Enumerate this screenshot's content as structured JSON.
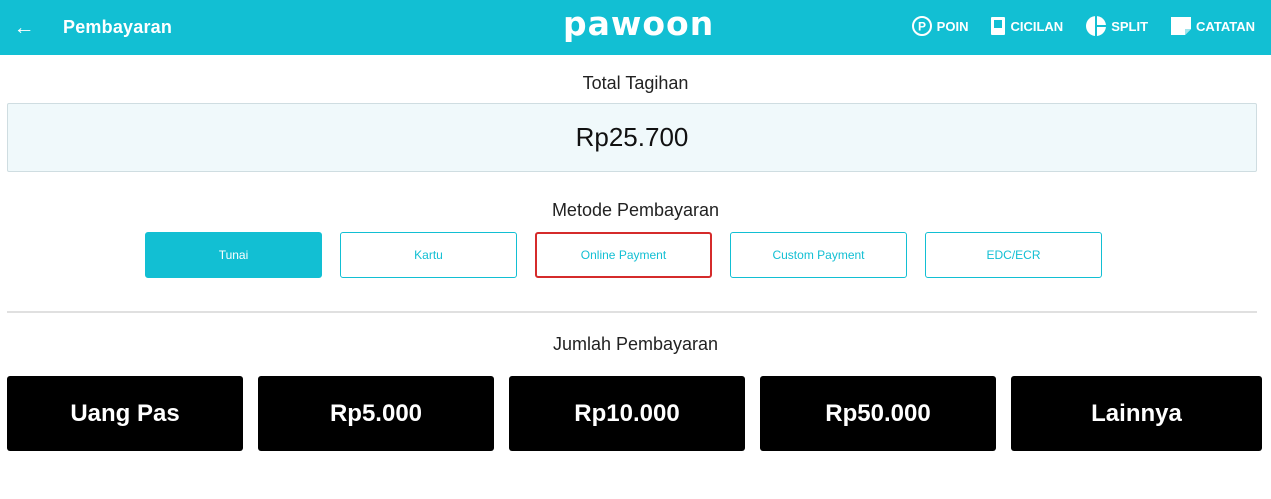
{
  "header": {
    "title": "Pembayaran",
    "logo": "pawoon",
    "back_icon": "arrow-left-icon",
    "actions": [
      {
        "label": "POIN",
        "icon": "poin-icon"
      },
      {
        "label": "CICILAN",
        "icon": "cicilan-icon"
      },
      {
        "label": "SPLIT",
        "icon": "split-icon"
      },
      {
        "label": "CATATAN",
        "icon": "catatan-icon"
      }
    ]
  },
  "total": {
    "label": "Total Tagihan",
    "value": "Rp25.700"
  },
  "payment_method": {
    "label": "Metode Pembayaran",
    "options": [
      "Tunai",
      "Kartu",
      "Online Payment",
      "Custom Payment",
      "EDC/ECR"
    ],
    "selected": "Tunai"
  },
  "payment_amount": {
    "label": "Jumlah Pembayaran",
    "options": [
      "Uang Pas",
      "Rp5.000",
      "Rp10.000",
      "Rp50.000",
      "Lainnya"
    ]
  },
  "colors": {
    "accent": "#12bfd3",
    "highlight": "#d52b2b",
    "amount_button": "#000000"
  }
}
